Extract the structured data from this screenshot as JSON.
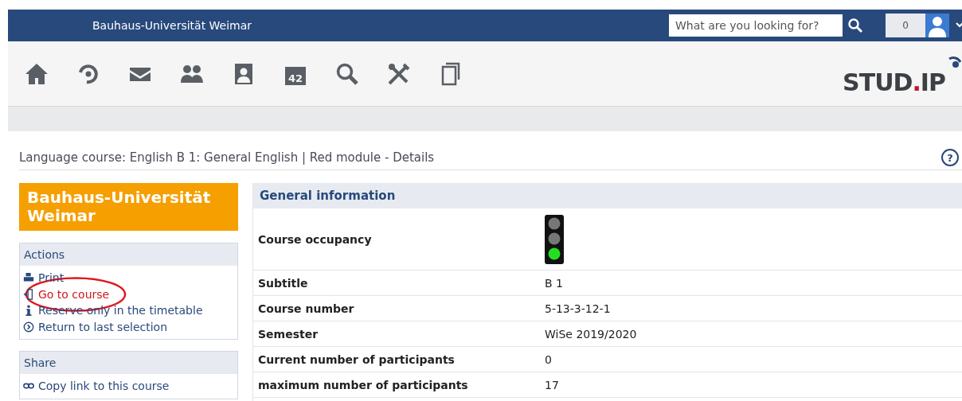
{
  "top_bar": {
    "site_name": "Bauhaus-Universität Weimar",
    "search": {
      "placeholder": "What are you looking for?"
    },
    "notifications": "0"
  },
  "nav": {
    "icons": [
      {
        "kind": "home"
      },
      {
        "kind": "ring"
      },
      {
        "kind": "mail"
      },
      {
        "kind": "people"
      },
      {
        "kind": "contact"
      },
      {
        "kind": "calendar",
        "text": "42"
      },
      {
        "kind": "search"
      },
      {
        "kind": "tools"
      },
      {
        "kind": "pages"
      }
    ],
    "logo": {
      "left": "STUD",
      "dot": ".",
      "right": "IP"
    }
  },
  "page_title": "Language course: English B 1: General English | Red module - Details",
  "help": "?",
  "sidebar": {
    "brand": "Bauhaus-Universität Weimar",
    "actions": {
      "title": "Actions",
      "items": [
        {
          "kind": "print",
          "label": "Print",
          "highlighted": false
        },
        {
          "kind": "door",
          "label": "Go to course",
          "highlighted": true
        },
        {
          "kind": "info",
          "label": "Reserve only in the timetable",
          "highlighted": false
        },
        {
          "kind": "back",
          "label": "Return to last selection",
          "highlighted": false
        }
      ]
    },
    "share": {
      "title": "Share",
      "items": [
        {
          "kind": "link",
          "label": "Copy link to this course",
          "highlighted": false
        }
      ]
    }
  },
  "details": {
    "title": "General information",
    "rows": [
      {
        "label": "Course occupancy",
        "kind": "light",
        "lamps": [
          {
            "on": false
          },
          {
            "on": false
          },
          {
            "on": true
          }
        ]
      },
      {
        "label": "Subtitle",
        "kind": "text",
        "value": "B 1"
      },
      {
        "label": "Course number",
        "kind": "text",
        "value": "5-13-3-12-1"
      },
      {
        "label": "Semester",
        "kind": "text",
        "value": "WiSe 2019/2020"
      },
      {
        "label": "Current number of participants",
        "kind": "text",
        "value": "0"
      },
      {
        "label": "maximum number of participants",
        "kind": "text",
        "value": "17"
      }
    ]
  }
}
